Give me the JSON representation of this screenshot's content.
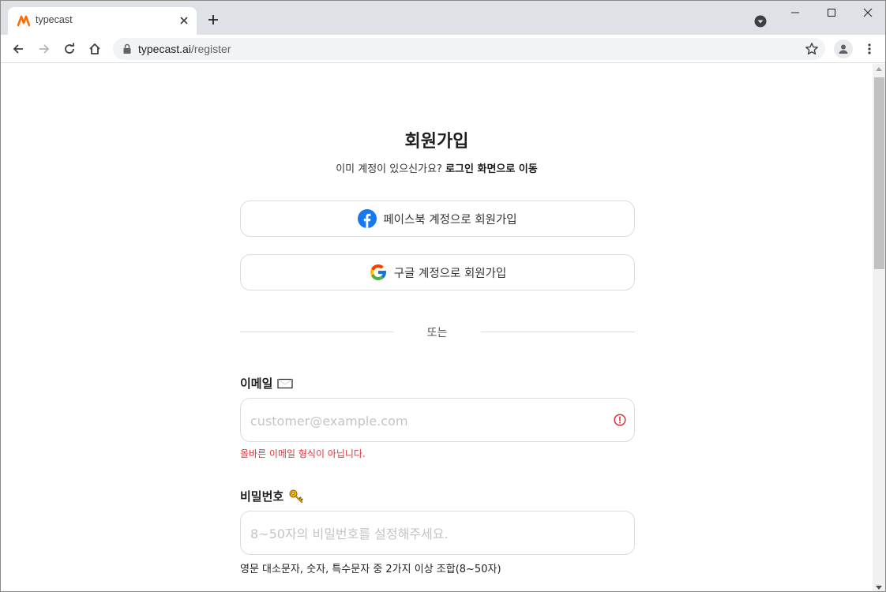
{
  "browser": {
    "tab_title": "typecast",
    "url_host": "typecast.ai",
    "url_path": "/register"
  },
  "page": {
    "title": "회원가입",
    "subtitle_prefix": "이미 계정이 있으신가요? ",
    "subtitle_link": "로그인 화면으로 이동",
    "facebook_button": "페이스북 계정으로 회원가입",
    "google_button": "구글 계정으로 회원가입",
    "divider": "또는",
    "email": {
      "label": "이메일",
      "placeholder": "customer@example.com",
      "error": "올바른 이메일 형식이 아닙니다."
    },
    "password": {
      "label": "비밀번호",
      "placeholder": "8~50자의 비밀번호를 설정해주세요.",
      "hint": "영문 대소문자, 숫자, 특수문자 중 2가지 이상 조합(8~50자)"
    }
  },
  "colors": {
    "error": "#e0323c",
    "facebook": "#1877f2",
    "tab_strip": "#dee1e6"
  },
  "icons": [
    "typecast-logo-icon",
    "close-icon",
    "plus-icon",
    "chevron-down-icon",
    "minimize-icon",
    "maximize-icon",
    "window-close-icon",
    "back-arrow-icon",
    "forward-arrow-icon",
    "reload-icon",
    "home-icon",
    "lock-icon",
    "star-icon",
    "profile-icon",
    "more-vert-icon",
    "facebook-icon",
    "google-icon",
    "envelope-icon",
    "key-icon",
    "error-icon"
  ]
}
